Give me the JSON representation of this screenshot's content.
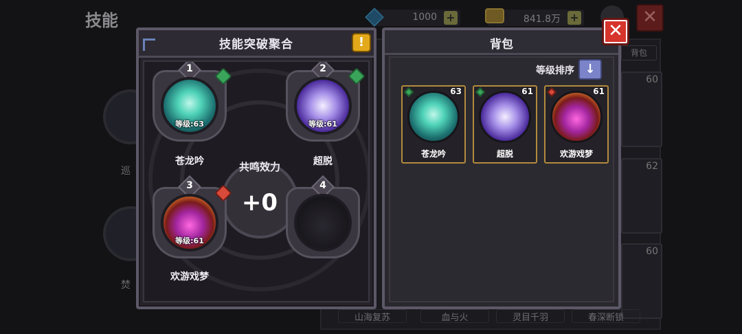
{
  "background": {
    "screen_title": "技能",
    "gem_value": "1000",
    "coin_value": "841.8万",
    "tab_label": "背包",
    "card_levels": [
      "60",
      "62",
      "60"
    ],
    "bottom_labels": [
      "山海复苏",
      "血与火",
      "灵目千羽",
      "春深断锁"
    ],
    "left_labels": [
      "巡",
      "焚"
    ]
  },
  "fusion": {
    "title": "技能突破聚合",
    "info_label": "!",
    "resonance_label": "共鸣效力",
    "resonance_value": "+0",
    "slots": [
      {
        "index": "1",
        "name": "苍龙吟",
        "level_text": "等级:63",
        "element": "green"
      },
      {
        "index": "2",
        "name": "超脱",
        "level_text": "等级:61",
        "element": "green"
      },
      {
        "index": "3",
        "name": "欢游戏梦",
        "level_text": "等级:61",
        "element": "red"
      },
      {
        "index": "4",
        "name": "",
        "level_text": "",
        "element": ""
      }
    ]
  },
  "bag": {
    "title": "背包",
    "sort_label": "等级排序",
    "sort_icon": "↓",
    "items": [
      {
        "name": "苍龙吟",
        "level": "63",
        "element": "green"
      },
      {
        "name": "超脱",
        "level": "61",
        "element": "green"
      },
      {
        "name": "欢游戏梦",
        "level": "61",
        "element": "red"
      }
    ]
  },
  "close_label": "✕",
  "colors": {
    "accent_gold": "#e3a91b",
    "close_red": "#d7342c",
    "sort_blue": "#7b84c8",
    "item_border": "#b38b3c"
  }
}
